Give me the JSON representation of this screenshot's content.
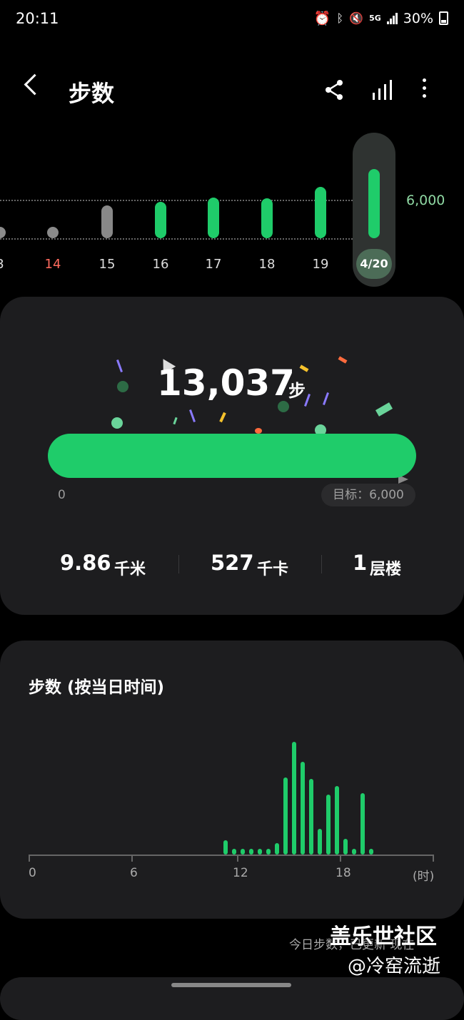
{
  "status_bar": {
    "time": "20:11",
    "network": "5G",
    "battery": "30%"
  },
  "header": {
    "title": "步数",
    "icons": [
      "share-icon",
      "stats-icon",
      "more-icon"
    ]
  },
  "weekly_chart": {
    "goal_label": "6,000",
    "days": [
      {
        "label": "3",
        "level": 0,
        "state": "dot"
      },
      {
        "label": "14",
        "level": 0,
        "state": "dot",
        "highlight": "sunday"
      },
      {
        "label": "15",
        "level": 0.7,
        "state": "below-goal"
      },
      {
        "label": "16",
        "level": 0.8,
        "state": "goal"
      },
      {
        "label": "17",
        "level": 0.9,
        "state": "goal"
      },
      {
        "label": "18",
        "level": 0.88,
        "state": "goal"
      },
      {
        "label": "19",
        "level": 1.18,
        "state": "goal"
      },
      {
        "label": "4/20",
        "level": 1.65,
        "state": "selected"
      }
    ]
  },
  "summary": {
    "steps": "13,037",
    "steps_unit": "步",
    "progress_fraction": 1.0,
    "progress_start": "0",
    "goal": "目标：6,000",
    "stats": [
      {
        "value": "9.86",
        "unit": "千米"
      },
      {
        "value": "527",
        "unit": "千卡"
      },
      {
        "value": "1",
        "unit": "层楼"
      }
    ]
  },
  "hourly": {
    "title": "步数 (按当日时间)",
    "axis_labels": [
      "0",
      "6",
      "12",
      "18",
      "(时)"
    ],
    "values": [
      {
        "hour": 11.5,
        "v": 0.1
      },
      {
        "hour": 12.0,
        "v": 0.04
      },
      {
        "hour": 12.5,
        "v": 0.04
      },
      {
        "hour": 13.0,
        "v": 0.04
      },
      {
        "hour": 13.5,
        "v": 0.04
      },
      {
        "hour": 14.0,
        "v": 0.04
      },
      {
        "hour": 14.5,
        "v": 0.08
      },
      {
        "hour": 15.0,
        "v": 0.54
      },
      {
        "hour": 15.5,
        "v": 0.79
      },
      {
        "hour": 16.0,
        "v": 0.65
      },
      {
        "hour": 16.5,
        "v": 0.53
      },
      {
        "hour": 17.0,
        "v": 0.18
      },
      {
        "hour": 17.5,
        "v": 0.42
      },
      {
        "hour": 18.0,
        "v": 0.48
      },
      {
        "hour": 18.5,
        "v": 0.11
      },
      {
        "hour": 19.0,
        "v": 0.04
      },
      {
        "hour": 19.5,
        "v": 0.43
      },
      {
        "hour": 20.0,
        "v": 0.04
      }
    ]
  },
  "footer": {
    "updated_text": "今日步数，已更新 现在",
    "watermark_title": "盖乐世社区",
    "watermark_user": "@冷窑流逝"
  },
  "colors": {
    "accent": "#1fcc6a",
    "card": "#1d1d1f",
    "sunday": "#ff6b5e"
  }
}
